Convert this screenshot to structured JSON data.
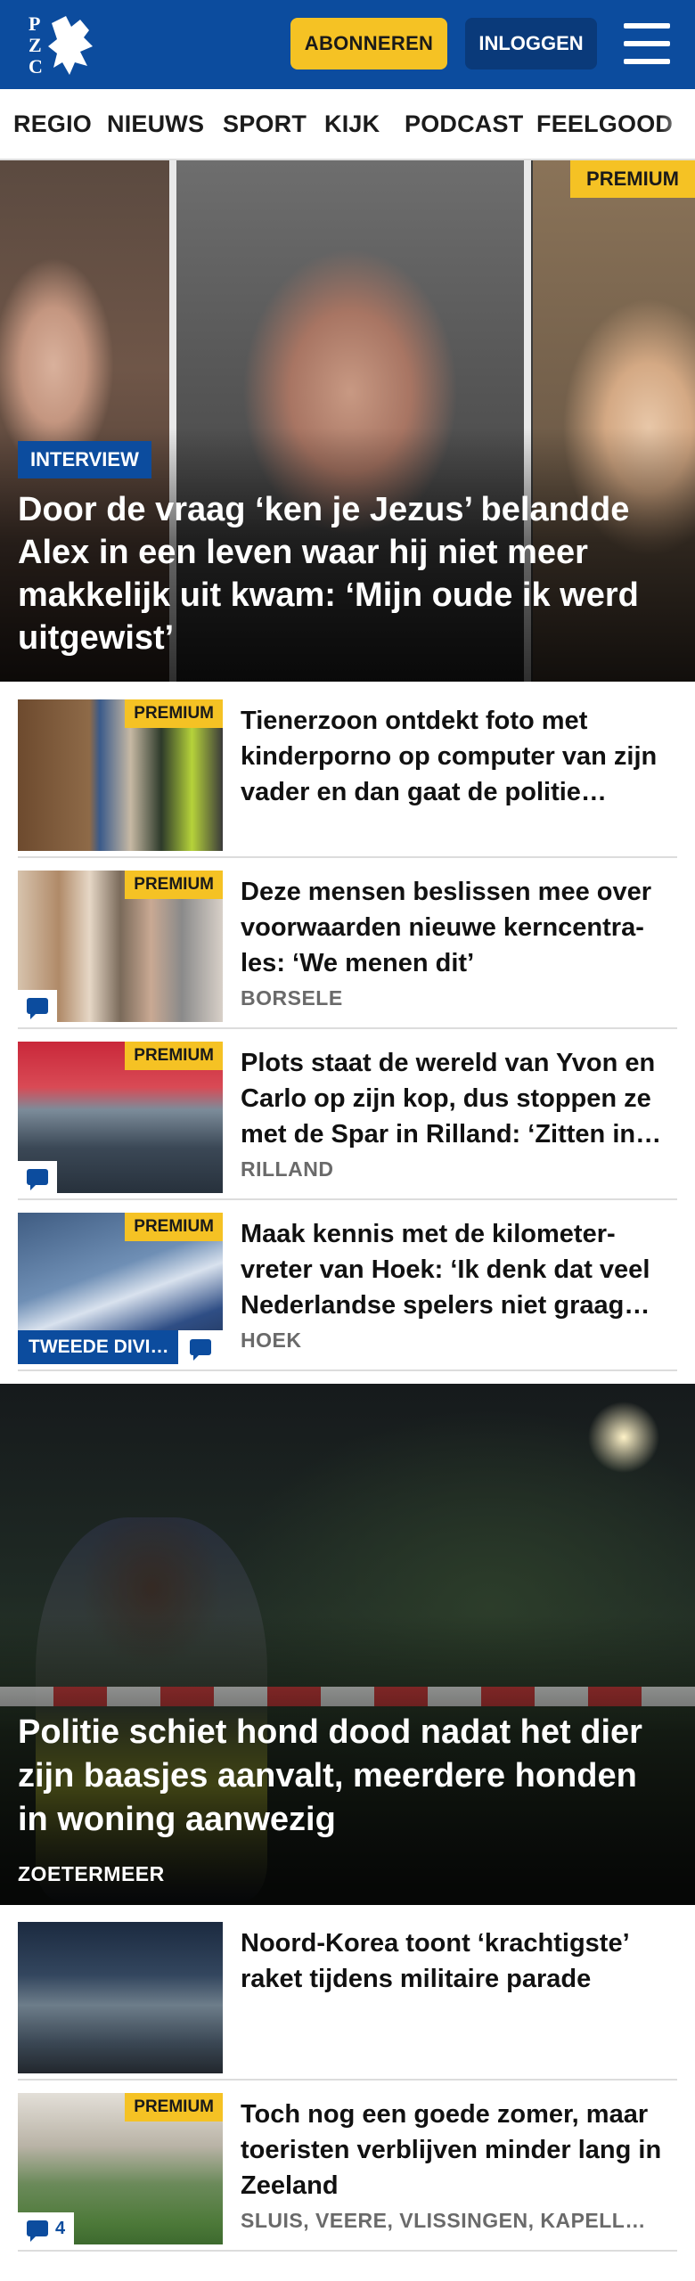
{
  "header": {
    "logo_text": "PZC",
    "subscribe_label": "ABONNEREN",
    "login_label": "INLOGGEN",
    "menu_icon": "hamburger-menu-icon",
    "brand_color": "#0c4c9e",
    "accent_color": "#f5c224"
  },
  "nav": {
    "items": [
      "REGIO",
      "NIEUWS",
      "SPORT",
      "KIJK",
      "PODCAST",
      "FEELGOOD"
    ]
  },
  "hero": {
    "badge": "PREMIUM",
    "label": "INTERVIEW",
    "title": "Door de vraag ‘ken je Jezus’ belandde Alex in een leven waar hij niet meer makkelijk uit kwam: ‘Mijn oude ik werd uitgewist’"
  },
  "articles": [
    {
      "badge": "PREMIUM",
      "title": "Tienerzoon ontdekt foto met kinderporno op computer van zijn vader en dan gaat de politie…",
      "tag": "",
      "comment_icon": "comment-icon"
    },
    {
      "badge": "PREMIUM",
      "title": "Deze mensen beslissen mee over voorwaarden nieuwe kerncentra­les: ‘We menen dit’",
      "tag": "BORSELE",
      "comment_icon": "comment-icon"
    },
    {
      "badge": "PREMIUM",
      "title": "Plots staat de wereld van Yvon en Carlo op zijn kop, dus stoppen ze met de Spar in Rilland: ‘Zitten in…",
      "tag": "RILLAND",
      "comment_icon": "comment-icon"
    },
    {
      "badge": "PREMIUM",
      "title": "Maak kennis met de kilometer­vreter van Hoek: ‘Ik denk dat veel Nederlandse spelers niet graag…",
      "tag": "HOEK",
      "section_label": "TWEEDE DIVI…",
      "comment_icon": "comment-icon"
    }
  ],
  "feature": {
    "title": "Politie schiet hond dood nadat het dier zijn baasjes aanvalt, meerdere honden in woning aanwezig",
    "tag": "ZOETERMEER"
  },
  "more_articles": [
    {
      "title": "Noord-Korea toont ‘krachtigste’ raket tijdens militaire parade",
      "tag": ""
    },
    {
      "badge": "PREMIUM",
      "title": "Toch nog een goede zomer, maar toeristen verblijven minder lang in Zeeland",
      "tag": "SLUIS, VEERE, VLISSINGEN, KAPELL…",
      "comment_count": "4",
      "comment_icon": "comment-icon"
    }
  ]
}
